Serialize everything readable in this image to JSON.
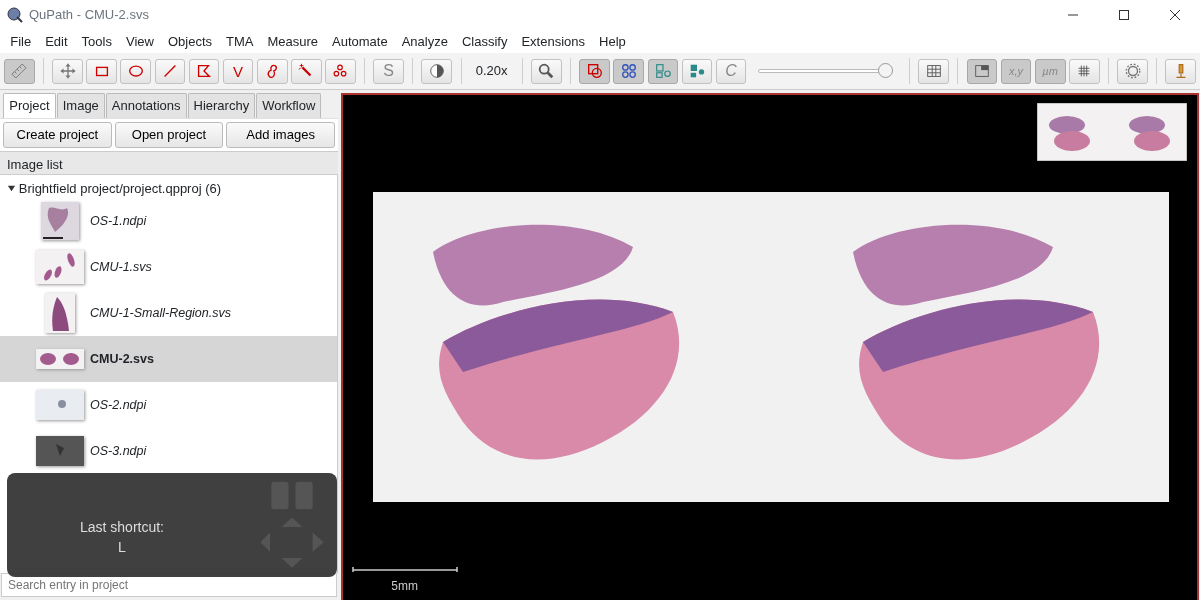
{
  "window": {
    "title": "QuPath - CMU-2.svs"
  },
  "menu": [
    "File",
    "Edit",
    "Tools",
    "View",
    "Objects",
    "TMA",
    "Measure",
    "Automate",
    "Analyze",
    "Classify",
    "Extensions",
    "Help"
  ],
  "toolbar": [
    {
      "kind": "button",
      "selected": true
    },
    {
      "kind": "separator"
    },
    {
      "kind": "button",
      "selected": false
    },
    {
      "kind": "button",
      "selected": false
    },
    {
      "kind": "button",
      "selected": false
    },
    {
      "kind": "button",
      "selected": false
    },
    {
      "kind": "button",
      "selected": false
    },
    {
      "kind": "button",
      "selected": false,
      "label": "V"
    },
    {
      "kind": "button",
      "selected": false
    },
    {
      "kind": "button",
      "selected": false
    },
    {
      "kind": "button",
      "selected": false
    },
    {
      "kind": "separator"
    },
    {
      "kind": "button",
      "selected": false,
      "label": "S"
    },
    {
      "kind": "separator"
    },
    {
      "kind": "button",
      "selected": false
    },
    {
      "kind": "separator"
    },
    {
      "kind": "text",
      "label": "0.20x"
    },
    {
      "kind": "separator"
    },
    {
      "kind": "button",
      "selected": false
    },
    {
      "kind": "separator"
    },
    {
      "kind": "button",
      "selected": true
    },
    {
      "kind": "button",
      "selected": true
    },
    {
      "kind": "button",
      "selected": true
    },
    {
      "kind": "button",
      "selected": false
    },
    {
      "kind": "button",
      "selected": false,
      "label": "C"
    },
    {
      "kind": "slider",
      "level": 1.0
    },
    {
      "kind": "separator"
    },
    {
      "kind": "button",
      "selected": false
    },
    {
      "kind": "separator"
    },
    {
      "kind": "button",
      "selected": true
    },
    {
      "kind": "button",
      "selected": true,
      "label": "x,y"
    },
    {
      "kind": "button",
      "selected": true,
      "label": "µm"
    },
    {
      "kind": "button",
      "selected": false
    },
    {
      "kind": "separator"
    },
    {
      "kind": "button",
      "selected": false
    },
    {
      "kind": "separator"
    },
    {
      "kind": "button",
      "selected": false
    }
  ],
  "tabs": [
    {
      "label": "Project",
      "selected": true
    },
    {
      "label": "Image",
      "selected": false
    },
    {
      "label": "Annotations",
      "selected": false
    },
    {
      "label": "Hierarchy",
      "selected": false
    },
    {
      "label": "Workflow",
      "selected": false
    }
  ],
  "project_buttons": [
    "Create project",
    "Open project",
    "Add images"
  ],
  "image_list": {
    "header": "Image list",
    "root": {
      "label": "Brightfield project/project.qpproj (6)",
      "expanded": true,
      "children": [
        {
          "name": "OS-1.ndpi",
          "selected": false
        },
        {
          "name": "CMU-1.svs",
          "selected": false
        },
        {
          "name": "CMU-1-Small-Region.svs",
          "selected": false
        },
        {
          "name": "CMU-2.svs",
          "selected": true
        },
        {
          "name": "OS-2.ndpi",
          "selected": false
        },
        {
          "name": "OS-3.ndpi",
          "selected": false
        }
      ]
    }
  },
  "shortcut_overlay": {
    "caption": "Last shortcut:",
    "key": "L"
  },
  "search": {
    "placeholder": "Search entry in project"
  },
  "viewer": {
    "scale_bar": "5mm"
  }
}
